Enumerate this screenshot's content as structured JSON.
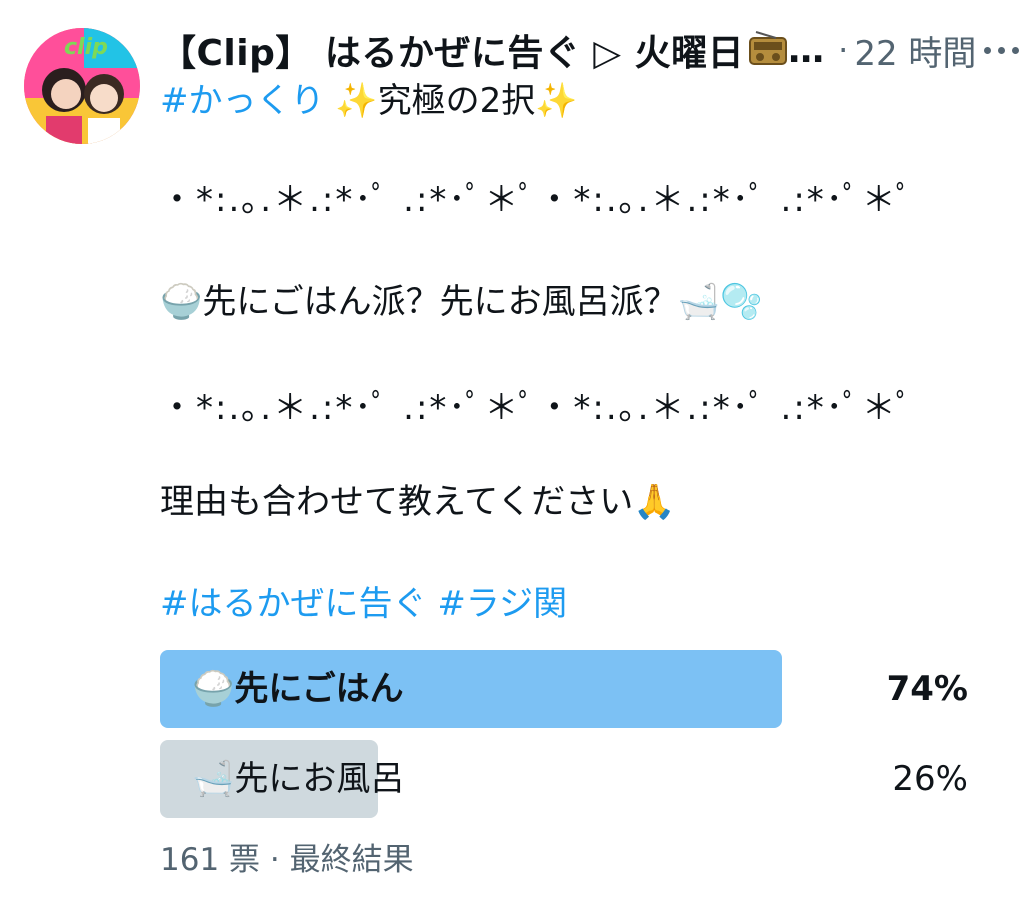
{
  "tweet": {
    "display_name": "【Clip】 はるかぜに告ぐ ▷ 火曜日",
    "name_ellipsis": "…",
    "separator": "·",
    "timestamp": "22 時間",
    "line1": {
      "hashtag": "#かっくり",
      "sparkle_left": "✨",
      "text": "究極の2択",
      "sparkle_right": "✨"
    },
    "divider": "・*:.｡.＊.:*･ﾟ .:*･ﾟ＊ﾟ・*:.｡.＊.:*･ﾟ .:*･ﾟ＊ﾟ",
    "question": {
      "rice_emoji": "🍚",
      "text": "先にごはん派？先にお風呂派？",
      "bath_emoji": "🛁",
      "bubbles_emoji": "🫧"
    },
    "reason": {
      "text": "理由も合わせて教えてください",
      "pray_emoji": "🙏"
    },
    "hashtags": [
      "#はるかぜに告ぐ",
      "#ラジ関"
    ]
  },
  "poll": {
    "options": [
      {
        "emoji": "🍚",
        "label": "先にごはん",
        "percent_text": "74%",
        "fraction": 0.74,
        "winner": true
      },
      {
        "emoji": "🛁",
        "label": "先にお風呂",
        "percent_text": "26%",
        "fraction": 0.26,
        "winner": false
      }
    ],
    "votes": "161 票",
    "separator": "·",
    "status": "最終結果"
  },
  "colors": {
    "hashtag": "#1d9bf0",
    "winner_bar": "#7cc1f4",
    "loser_bar": "#cfd9de",
    "secondary_text": "#536471"
  },
  "icons": {
    "avatar": "profile-photo",
    "more": "more-horizontal-icon",
    "radio": "radio-emoji-icon"
  }
}
